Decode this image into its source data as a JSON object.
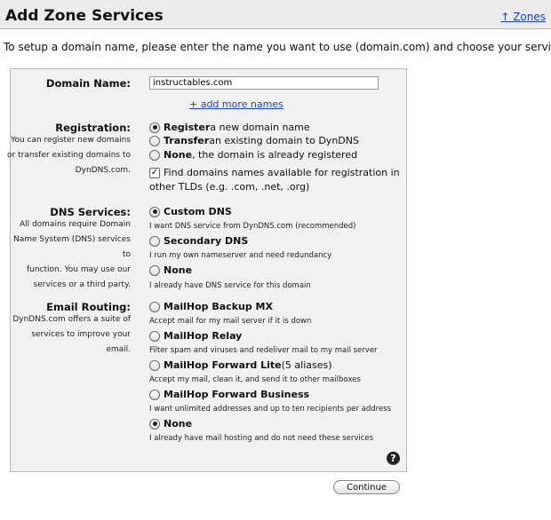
{
  "header": {
    "title": "Add Zone Services",
    "zones_link": "↑ Zones"
  },
  "intro": "To setup a domain name, please enter the name you want to use (domain.com) and choose your services.",
  "domain": {
    "label": "Domain Name:",
    "value": "instructables.com",
    "add_more": "+ add more names"
  },
  "registration": {
    "label": "Registration:",
    "desc": [
      "You can register new domains",
      "or transfer existing domains to",
      "DynDNS.com."
    ],
    "options": [
      {
        "bold": "Register",
        "rest": " a new domain name",
        "selected": true
      },
      {
        "bold": "Transfer",
        "rest": " an existing domain to DynDNS",
        "selected": false
      },
      {
        "bold": "None",
        "rest": ", the domain is already registered",
        "selected": false
      }
    ],
    "tld_check": {
      "line1": "Find domains names available for registration in",
      "line2": "other TLDs (e.g. .com, .net, .org)",
      "checked": true
    }
  },
  "dns": {
    "label": "DNS Services:",
    "desc": [
      "All domains require Domain",
      "Name System (DNS) services to",
      "function. You may use our",
      "services or a third party."
    ],
    "options": [
      {
        "name": "Custom DNS",
        "sub": "I want DNS service from DynDNS.com (recommended)",
        "selected": true
      },
      {
        "name": "Secondary DNS",
        "sub": "I run my own nameserver and need redundancy",
        "selected": false
      },
      {
        "name": "None",
        "sub": "I already have DNS service for this domain",
        "selected": false
      }
    ]
  },
  "email": {
    "label": "Email Routing:",
    "desc": [
      "DynDNS.com offers a suite of",
      "services to improve your",
      "email."
    ],
    "options": [
      {
        "name": "MailHop Backup MX",
        "extra": "",
        "sub": "Accept mail for my mail server if it is down",
        "selected": false
      },
      {
        "name": "MailHop Relay",
        "extra": "",
        "sub": "Filter spam and viruses and redeliver mail to my mail server",
        "selected": false
      },
      {
        "name": "MailHop Forward Lite",
        "extra": " (5 aliases)",
        "sub": "Accept my mail, clean it, and send it to other mailboxes",
        "selected": false
      },
      {
        "name": "MailHop Forward Business",
        "extra": "",
        "sub": "I want unlimited addresses and up to ten recipients per address",
        "selected": false
      },
      {
        "name": "None",
        "extra": "",
        "sub": "I already have mail hosting and do not need these services",
        "selected": true
      }
    ]
  },
  "help_icon": "?",
  "continue_label": "Continue"
}
